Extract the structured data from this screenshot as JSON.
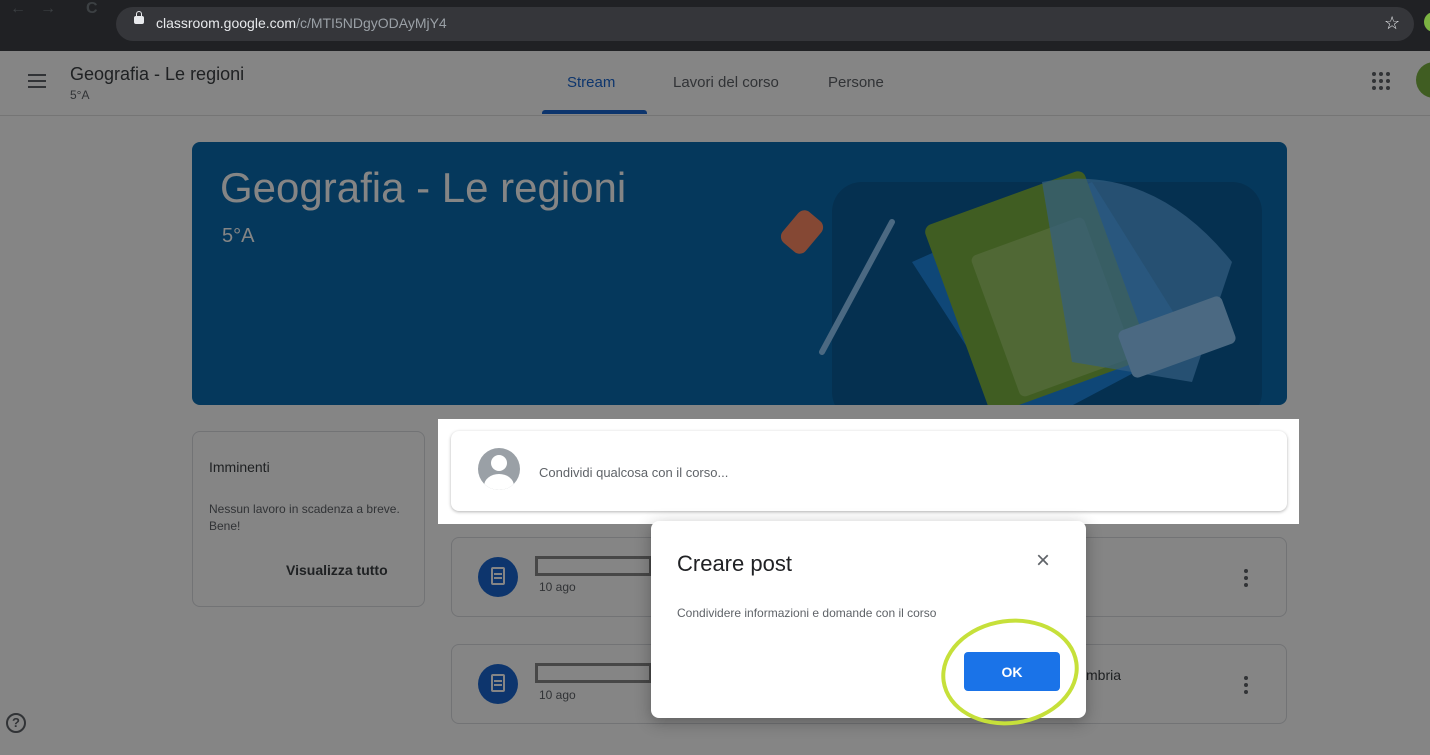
{
  "browser": {
    "url_domain": "classroom.google.com",
    "url_path": "/c/MTI5NDgyODAyMjY4",
    "back": "←",
    "forward": "→",
    "reload": "C",
    "bookmark_star": "☆"
  },
  "header": {
    "course_name": "Geografia - Le regioni",
    "course_section": "5°A",
    "tabs": [
      {
        "label": "Stream",
        "active": true
      },
      {
        "label": "Lavori del corso",
        "active": false
      },
      {
        "label": "Persone",
        "active": false
      }
    ]
  },
  "banner": {
    "title": "Geografia - Le regioni",
    "section": "5°A"
  },
  "upcoming": {
    "title": "Imminenti",
    "text": "Nessun lavoro in scadenza a breve. Bene!",
    "link": "Visualizza tutto"
  },
  "share": {
    "placeholder": "Condividi qualcosa con il corso..."
  },
  "posts": [
    {
      "date": "10 ago",
      "text": ""
    },
    {
      "date": "10 ago",
      "text": "mbria"
    }
  ],
  "dialog": {
    "title": "Creare post",
    "close": "×",
    "text": "Condividere informazioni e domande con il corso",
    "ok_label": "OK"
  },
  "help": "?",
  "colors": {
    "accent": "#1967d2",
    "banner": "#0a6cb0",
    "button": "#1a73e8",
    "highlight": "#c6e03a"
  }
}
